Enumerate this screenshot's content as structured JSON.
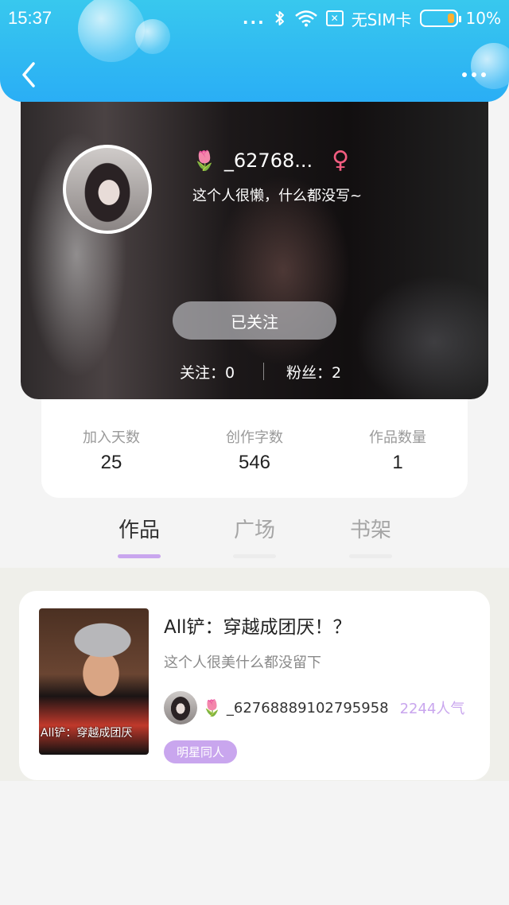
{
  "status_bar": {
    "time": "15:37",
    "dots": "...",
    "carrier": "无SIM卡",
    "battery": "10%",
    "battery_level": 0.1
  },
  "header": {
    "back_icon": "chevron-left-icon",
    "more_icon": "more-dots-icon"
  },
  "profile": {
    "name_emoji": "🌷",
    "username": "_62768...",
    "gender_symbol": "♀",
    "bio": "这个人很懒，什么都没写~",
    "follow_button": "已关注",
    "following": "关注：0",
    "followers": "粉丝：2"
  },
  "stats": [
    {
      "label": "加入天数",
      "value": "25"
    },
    {
      "label": "创作字数",
      "value": "546"
    },
    {
      "label": "作品数量",
      "value": "1"
    }
  ],
  "tabs": [
    {
      "label": "作品",
      "active": true
    },
    {
      "label": "广场",
      "active": false
    },
    {
      "label": "书架",
      "active": false
    }
  ],
  "works": [
    {
      "cover_text": "All铲：穿越成团厌",
      "title": "All铲：穿越成团厌！？",
      "description": "这个人很美什么都没留下",
      "author_emoji": "🌷",
      "author": "_62768889102795958",
      "popularity": "2244人气",
      "tag": "明星同人"
    }
  ],
  "colors": {
    "header_top": "#38c8ee",
    "header_bottom": "#2aaef5",
    "accent_purple": "#c9a6ee",
    "female_pink": "#f25d80",
    "battery_orange": "#ffb02e"
  }
}
